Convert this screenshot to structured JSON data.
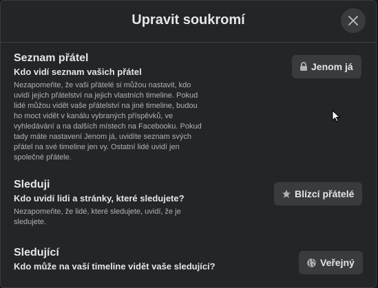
{
  "dialog": {
    "title": "Upravit soukromí",
    "close_icon": "close-icon"
  },
  "sections": [
    {
      "title": "Seznam přátel",
      "subtitle": "Kdo vidí seznam vašich přátel",
      "description": "Nezapomeňte, že vaši přátelé si můžou nastavit, kdo uvidí jejich přátelství na jejich vlastních timeline. Pokud lidé můžou vidět vaše přátelství na jiné timeline, budou ho moct vidět v kanálu vybraných příspěvků, ve vyhledávání a na dalších místech na Facebooku. Pokud tady máte nastavení Jenom já, uvidíte seznam svých přátel na své timeline jen vy. Ostatní lidé uvidí jen společné přátele.",
      "audience": {
        "label": "Jenom já",
        "icon": "lock-icon"
      }
    },
    {
      "title": "Sleduji",
      "subtitle": "Kdo uvidí lidi a stránky, které sledujete?",
      "description": "Nezapomeňte, že lidé, které sledujete, uvidí, že je sledujete.",
      "audience": {
        "label": "Blízcí přátelé",
        "icon": "star-icon"
      }
    },
    {
      "title": "Sledující",
      "subtitle": "Kdo může na vaší timeline vidět vaše sledující?",
      "audience": {
        "label": "Veřejný",
        "icon": "globe-icon"
      }
    }
  ],
  "colors": {
    "background": "#242526",
    "button": "#3a3b3c",
    "text_primary": "#e4e6eb",
    "text_secondary": "#b0b3b8"
  }
}
